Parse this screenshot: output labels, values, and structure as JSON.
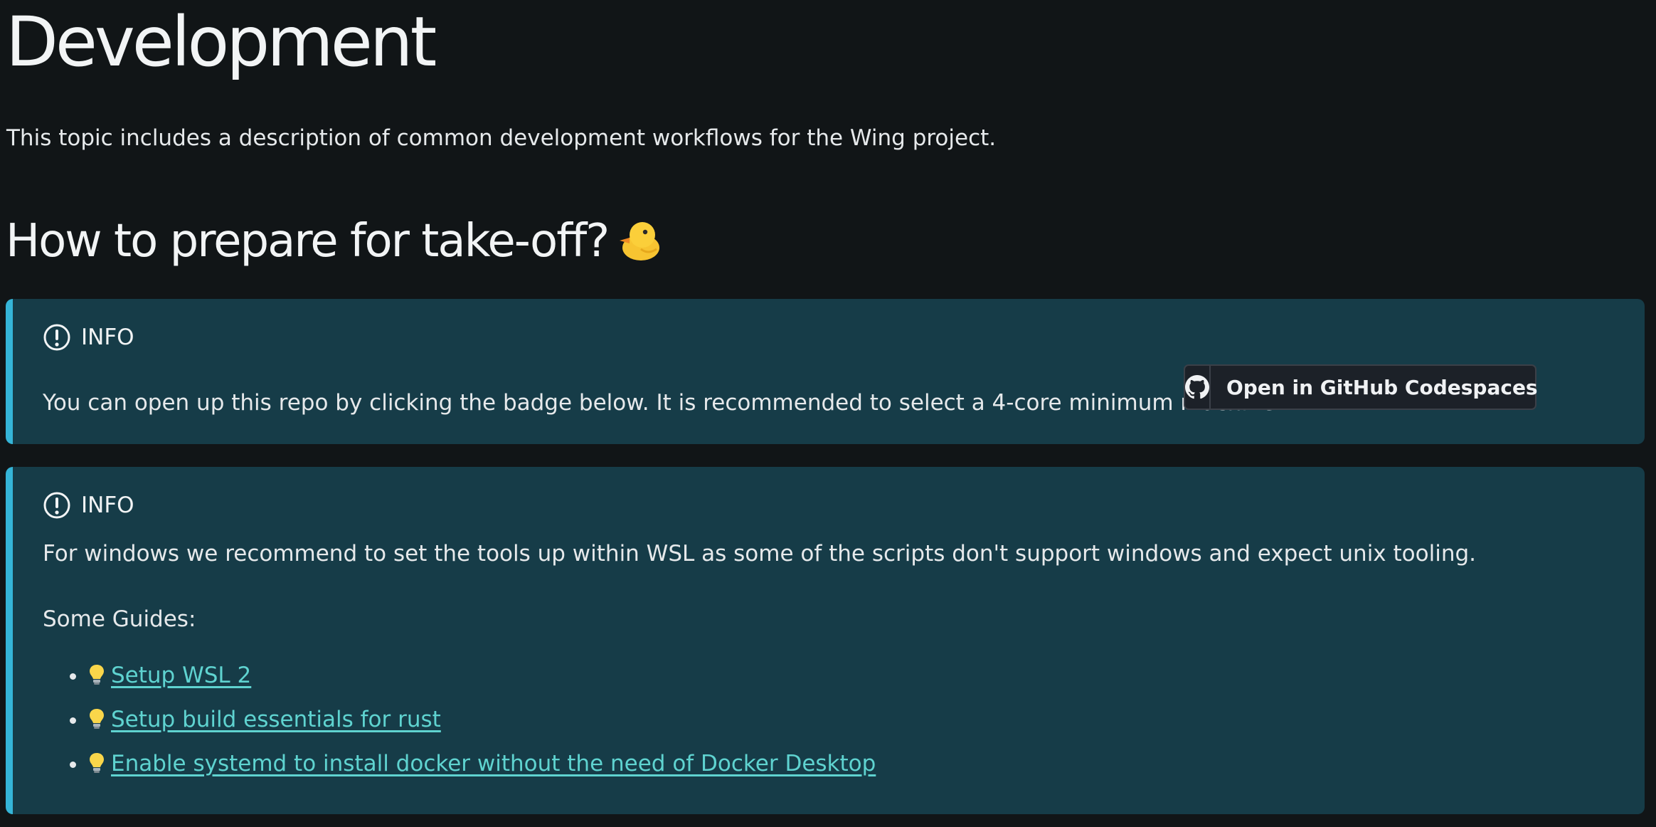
{
  "page": {
    "title": "Development",
    "intro": "This topic includes a description of common development workflows for the Wing project."
  },
  "section": {
    "title": "How to prepare for take-off?",
    "emoji_icon": "baby-chick-icon"
  },
  "info_box_1": {
    "label": "INFO",
    "icon": "info-icon",
    "text": "You can open up this repo by clicking the badge below. It is recommended to select a 4-core minimum machine.",
    "badge_label": "Open in GitHub Codespaces",
    "badge_icon": "github-icon"
  },
  "info_box_2": {
    "label": "INFO",
    "icon": "info-icon",
    "text": "For windows we recommend to set the tools up within WSL as some of the scripts don't support windows and expect unix tooling.",
    "guides_heading": "Some Guides:",
    "guides": [
      {
        "label": "Setup WSL 2",
        "icon": "lightbulb-icon"
      },
      {
        "label": "Setup build essentials for rust",
        "icon": "lightbulb-icon"
      },
      {
        "label": "Enable systemd to install docker without the need of Docker Desktop",
        "icon": "lightbulb-icon"
      }
    ]
  },
  "colors": {
    "background": "#111517",
    "admonition_bg": "#163c48",
    "admonition_border": "#35b5d8",
    "link": "#5fd3d0",
    "text": "#e6e9eb"
  }
}
